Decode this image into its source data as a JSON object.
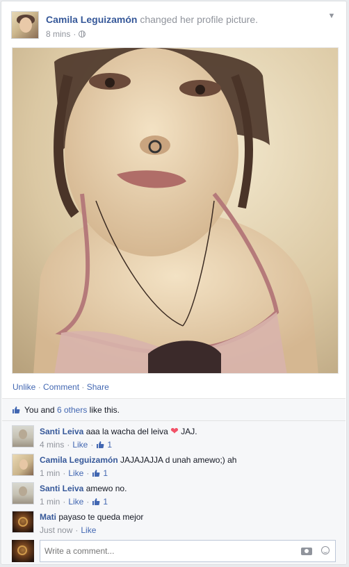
{
  "post": {
    "author": "Camila Leguizamón",
    "action": "changed her profile picture.",
    "time": "8 mins",
    "separator": "·",
    "privacy_icon": "globe-icon",
    "menu_icon": "chevron-down-icon"
  },
  "actions": {
    "unlike": "Unlike",
    "comment": "Comment",
    "share": "Share",
    "sep": " · "
  },
  "likes": {
    "you": "You and ",
    "others": "6 others",
    "suffix": " like this."
  },
  "comments": [
    {
      "name": "Santi Leiva",
      "text": "aaa la wacha del leiva",
      "text_after": " JAJ.",
      "has_heart": true,
      "time": "4 mins",
      "like": "Like",
      "count": "1"
    },
    {
      "name": "Camila Leguizamón",
      "text": "JAJAJAJJA d unah amewo;) ah",
      "time": "1 min",
      "like": "Like",
      "count": "1"
    },
    {
      "name": "Santi Leiva",
      "text": "amewo no.",
      "time": "1 min",
      "like": "Like",
      "count": "1"
    },
    {
      "name": "Mati",
      "text": "payaso te queda mejor",
      "time": "Just now",
      "like": "Like"
    }
  ],
  "write_comment": {
    "placeholder": "Write a comment..."
  },
  "colors": {
    "link": "#365899",
    "accent": "#4267b2",
    "heart": "#f25268"
  }
}
